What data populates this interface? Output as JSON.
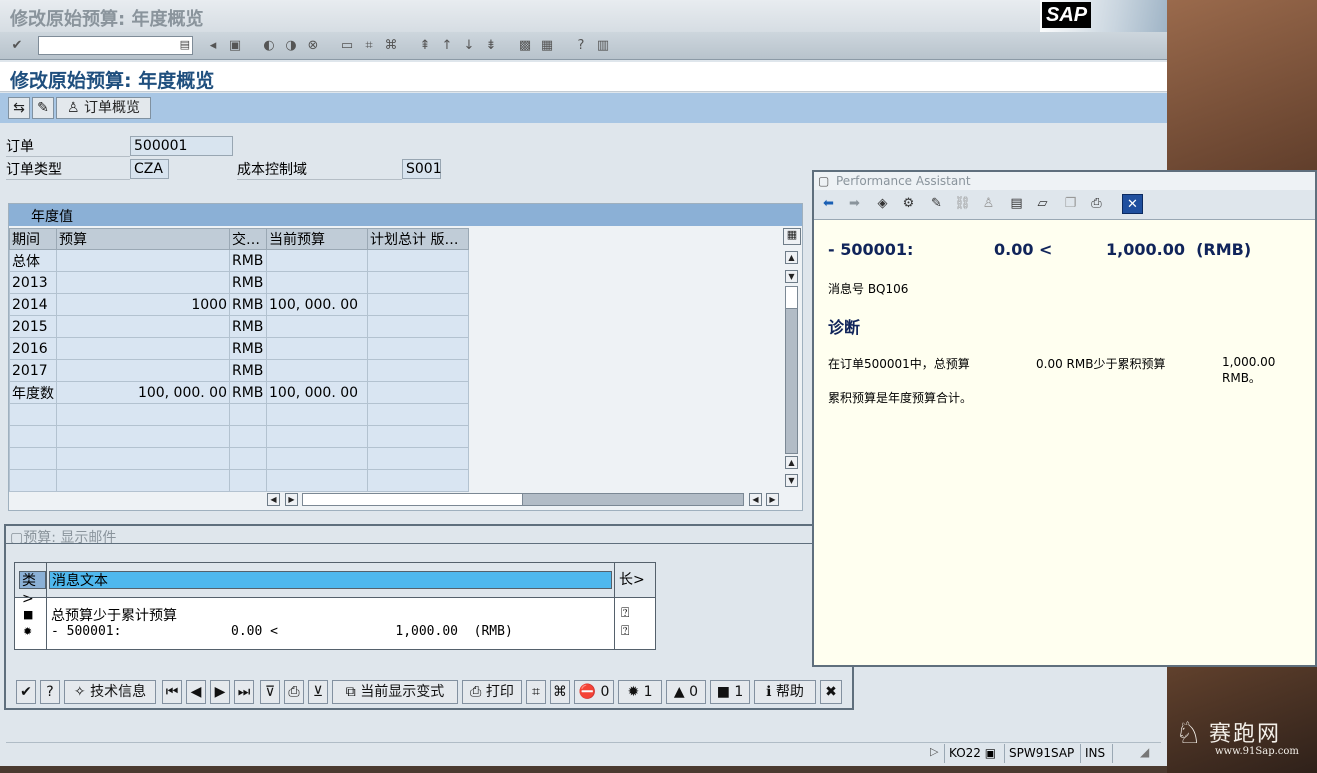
{
  "window": {
    "title": "修改原始预算: 年度概览",
    "logo": "SAP"
  },
  "system_toolbar": {
    "cmd_value": "",
    "icons": [
      "enter-icon",
      "back-icon",
      "save-icon",
      "nav-back-icon",
      "exit-icon",
      "cancel-icon",
      "print-icon",
      "find-icon",
      "find-next-icon",
      "first-page-icon",
      "prev-page-icon",
      "next-page-icon",
      "last-page-icon",
      "new-session-icon",
      "shortcut-icon",
      "help-icon",
      "layout-icon"
    ]
  },
  "screen_title": "修改原始预算: 年度概览",
  "app_toolbar": {
    "order_overview": "订单概览"
  },
  "form": {
    "order_label": "订单",
    "order_value": "500001",
    "order_type_label": "订单类型",
    "order_type_value": "CZA",
    "co_area_label": "成本控制域",
    "co_area_value": "S001"
  },
  "table": {
    "title": "年度值",
    "columns": [
      "期间",
      "预算",
      "交…",
      "当前预算",
      "计划总计 版…"
    ],
    "rows": [
      [
        "总体",
        "",
        "RMB",
        "",
        ""
      ],
      [
        "2013",
        "",
        "RMB",
        "",
        ""
      ],
      [
        "2014",
        "1000",
        "RMB",
        "100, 000. 00",
        ""
      ],
      [
        "2015",
        "",
        "RMB",
        "",
        ""
      ],
      [
        "2016",
        "",
        "RMB",
        "",
        ""
      ],
      [
        "2017",
        "",
        "RMB",
        "",
        ""
      ],
      [
        "年度数",
        "100, 000. 00",
        "RMB",
        "100, 000. 00",
        ""
      ],
      [
        "",
        "",
        "",
        "",
        ""
      ],
      [
        "",
        "",
        "",
        "",
        ""
      ],
      [
        "",
        "",
        "",
        "",
        ""
      ],
      [
        "",
        "",
        "",
        "",
        ""
      ]
    ]
  },
  "message_dialog": {
    "title": "预算: 显示邮件",
    "col_type": "类>",
    "col_text": "消息文本",
    "col_long": "长>",
    "msg1": "总预算少于累计预算",
    "msg2": "- 500001:              0.00 <               1,000.00  (RMB)",
    "toolbar": {
      "tech_info": "技术信息",
      "current_variant": "当前显示变式",
      "print": "打印",
      "stop_count": "0",
      "error_count": "1",
      "warning_count": "0",
      "info_count": "1",
      "help": "帮助"
    }
  },
  "perf_assistant": {
    "title": "Performance Assistant",
    "headline_prefix": "- 500001:",
    "headline_amount1": "0.00 <",
    "headline_amount2": "1,000.00  (RMB)",
    "msg_no": "消息号  BQ106",
    "diag_title": "诊断",
    "diag_line1_a": "在订单500001中，总预算",
    "diag_line1_b": "0.00 RMB少于累积预算",
    "diag_line1_c": "1,000.00 RMB。",
    "diag_line2": "累积预算是年度预算合计。"
  },
  "statusbar": {
    "tcode": "KO22",
    "server": "SPW91SAP",
    "mode": "INS"
  },
  "watermark": {
    "name": "赛跑网",
    "url": "www.91Sap.com"
  },
  "colors": {
    "accent": "#1f4f7e",
    "toolbar_blue": "#a8c6e4",
    "table_header": "#8bb0d6",
    "cell": "#d9e5f2"
  }
}
